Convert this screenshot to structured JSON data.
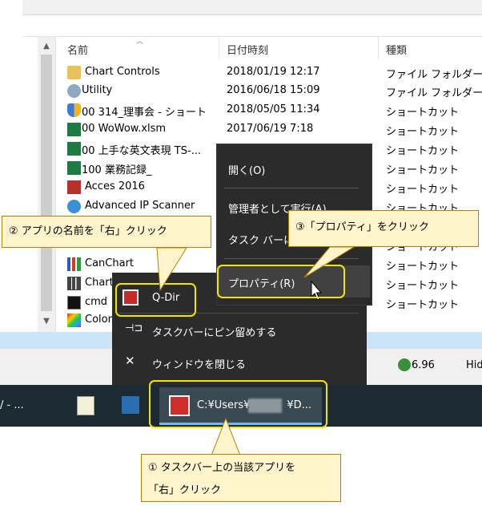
{
  "explorer": {
    "columns": {
      "name": "名前",
      "date": "日付時刻",
      "type": "種類"
    },
    "rows": [
      {
        "name": "Chart Controls",
        "date": "2018/01/19 12:17",
        "type": "ファイル フォルダー",
        "icon": "folder-icon"
      },
      {
        "name": "Utility",
        "date": "2016/06/18 15:09",
        "type": "ファイル フォルダー",
        "icon": "gear-folder-icon"
      },
      {
        "name": "00 314_理事会 - ショート",
        "date": "2018/05/05 11:34",
        "type": "ショートカット",
        "icon": "shield-icon"
      },
      {
        "name": "00 WoWow.xlsm",
        "date": "2017/06/19 7:18",
        "type": "ショートカット",
        "icon": "excel-icon"
      },
      {
        "name": "00 上手な英文表現 TS-...",
        "date": "",
        "type": "ショートカット",
        "icon": "excel-icon"
      },
      {
        "name": "100 業務記録_",
        "date": "",
        "type": "ショートカット",
        "icon": "excel-icon"
      },
      {
        "name": "Acces 2016",
        "date": "",
        "type": "ショートカット",
        "icon": "access-icon"
      },
      {
        "name": "Advanced IP Scanner",
        "date": "",
        "type": "ショートカット",
        "icon": "scanner-icon"
      },
      {
        "name": "",
        "date": "",
        "type": "ショートカット",
        "icon": "app-icon"
      },
      {
        "name": "CanChart",
        "date": "",
        "type": "ショートカット",
        "icon": "chart-icon"
      },
      {
        "name": "Chart",
        "date": "",
        "type": "ショートカット",
        "icon": "chart-icon"
      },
      {
        "name": "cmd",
        "date": "",
        "type": "ショートカット",
        "icon": "cmd-icon"
      },
      {
        "name": "Color",
        "date": "",
        "type": "ショートカット",
        "icon": "color-icon"
      }
    ],
    "status": {
      "value": "6.96",
      "cut": "Hid"
    }
  },
  "context_menu": {
    "open": "開く(O)",
    "run_as_admin": "管理者として実行(A)",
    "pin_taskbar": "タスク バーに",
    "properties": "プロパティ(R)"
  },
  "jump_list": {
    "app": "Q-Dir",
    "pin": "タスクバーにピン留めする",
    "close": "ウィンドウを閉じる"
  },
  "taskbar": {
    "left_label": "/ - ...",
    "active_path_prefix": "C:¥Users¥",
    "active_path_suffix": "¥D..."
  },
  "callouts": {
    "step1_line1": "① タスクバー上の当該アプリを",
    "step1_line2": "「右」クリック",
    "step2": "② アプリの名前を「右」クリック",
    "step3": "③「プロパティ」をクリック"
  },
  "colors": {
    "highlight": "#f2e500",
    "callout_bg": "#fff4cc",
    "callout_border": "#b08200",
    "menu_bg": "#2b2b2b",
    "taskbar_bg": "#1c2b32"
  }
}
